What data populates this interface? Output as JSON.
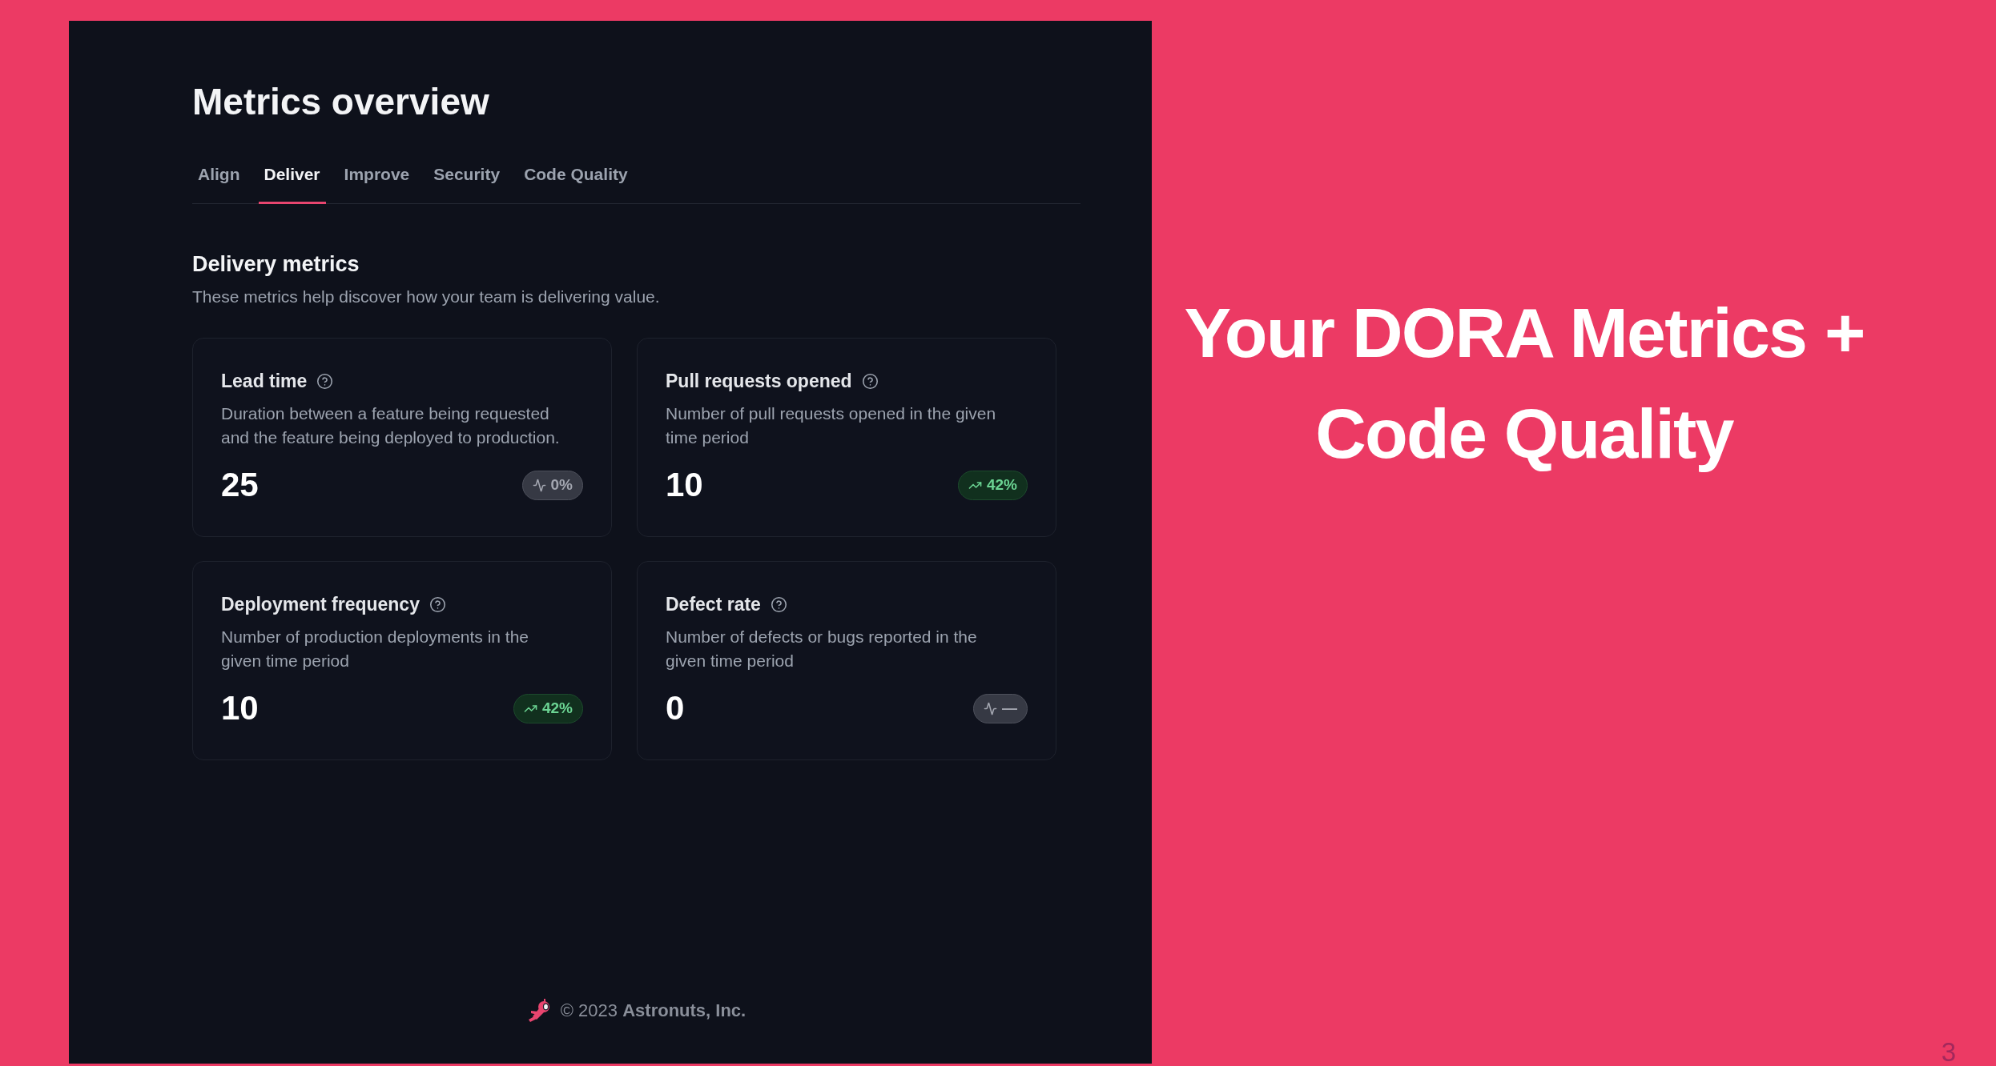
{
  "page": {
    "title": "Metrics overview",
    "tabs": [
      {
        "label": "Align",
        "selected": false
      },
      {
        "label": "Deliver",
        "selected": true
      },
      {
        "label": "Improve",
        "selected": false
      },
      {
        "label": "Security",
        "selected": false
      },
      {
        "label": "Code Quality",
        "selected": false
      }
    ],
    "section": {
      "title": "Delivery metrics",
      "description": "These metrics help discover how your team is delivering value."
    },
    "cards": [
      {
        "title": "Lead time",
        "description": "Duration between a feature being requested and the feature being deployed to production.",
        "value": "25",
        "trend": {
          "kind": "neutral",
          "label": "0%"
        }
      },
      {
        "title": "Pull requests opened",
        "description": "Number of pull requests opened in the given time period",
        "value": "10",
        "trend": {
          "kind": "up",
          "label": "42%"
        }
      },
      {
        "title": "Deployment frequency",
        "description": "Number of production deployments in the given time period",
        "value": "10",
        "trend": {
          "kind": "up",
          "label": "42%"
        }
      },
      {
        "title": "Defect rate",
        "description": "Number of defects or bugs reported in the given time period",
        "value": "0",
        "trend": {
          "kind": "neutral",
          "label": "—"
        }
      }
    ],
    "footer": {
      "text": "© 2023 **Astronuts, Inc.**"
    }
  },
  "slide": {
    "heading": "Your DORA Metrics + Code Quality",
    "page_number": "3"
  }
}
